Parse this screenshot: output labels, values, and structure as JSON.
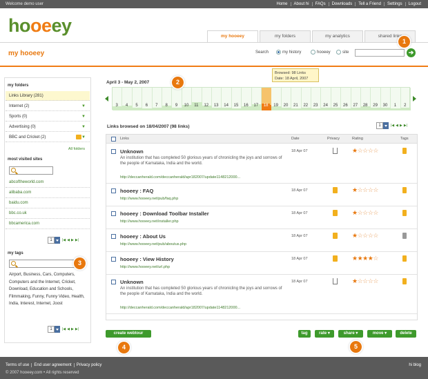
{
  "topbar": {
    "welcome": "Welcome demo user",
    "links": [
      "Home",
      "About hi",
      "FAQs",
      "Downloads",
      "Tell a Friend",
      "Settings",
      "Logout"
    ]
  },
  "brand": {
    "part1": "ho",
    "part2": "oe",
    "part3": "ey"
  },
  "tabs": [
    "my hooeey",
    "my folders",
    "my analytics",
    "shared links"
  ],
  "header": {
    "title": "my hooeey",
    "search_label": "Search",
    "radio_options": [
      "my history",
      "hooeey",
      "site"
    ],
    "radio_selected": "my history",
    "search_placeholder": "",
    "go_symbol": "➔"
  },
  "sidebar": {
    "folders_heading": "my folders",
    "folders": [
      {
        "label": "Links Library (281)"
      },
      {
        "label": "Internet (2)"
      },
      {
        "label": "Sports (0)"
      },
      {
        "label": "Advertising (0)"
      },
      {
        "label": "BBC and Cricket (2)"
      }
    ],
    "all_folders": "All folders",
    "most_visited_heading": "most visited sites",
    "sites": [
      "abcoftheworld.com",
      "alibaba.com",
      "baidu.com",
      "bbc.co.uk",
      "bbcamerica.com"
    ],
    "pager_value": "1",
    "tags_heading": "my tags",
    "tags_text": "Airport, Business, Cars, Computers, Computers and the Internet, Cricket, Download, Education and Schools, Filmmaking, Funny, Funny Video, Health, India, Interest, Internet, Joost"
  },
  "timeline": {
    "date_range": "April 3 - May 2, 2007",
    "tooltip_line1": "Browsed: 98 Links",
    "tooltip_line2": "Date: 18 April, 2007",
    "labels": [
      "3",
      "4",
      "5",
      "6",
      "7",
      "8",
      "9",
      "10",
      "11",
      "12",
      "13",
      "14",
      "15",
      "16",
      "17",
      "18",
      "19",
      "20",
      "21",
      "22",
      "23",
      "24",
      "25",
      "26",
      "27",
      "28",
      "29",
      "30",
      "1",
      "2"
    ],
    "values": [
      0.25,
      0.3,
      0.2,
      0.15,
      0.2,
      0.3,
      0.2,
      0.35,
      0.55,
      0.3,
      0.2,
      0.2,
      0.15,
      0.25,
      0.4,
      0.95,
      0.25,
      0.2,
      0.15,
      0.2,
      0.15,
      0.2,
      0.2,
      0.15,
      0.2,
      0.25,
      0.2,
      0.2,
      0.15,
      0.2
    ],
    "selected_index": 15
  },
  "list": {
    "title": "Links browsed on 18/04/2007 (98 links)",
    "pager_value": "1",
    "columns": {
      "links": "Links",
      "date": "Date",
      "privacy": "Privacy",
      "rating": "Rating",
      "tags": "Tags"
    },
    "rows": [
      {
        "title": "Unknown",
        "desc": "An institution that has completed 50 glorious years of chronicling the joys and sorrows of the people of Karnataka, India and the world.",
        "url": "http://deccanherald.com/deccanherald/apr182007/update1148212000...",
        "date": "18 Apr 07",
        "privacy": "open",
        "rating": 1,
        "tag": "yellow"
      },
      {
        "title": "hooeey : FAQ",
        "desc": "",
        "url": "http://www.hooeey.net/pub/faq.php",
        "date": "18 Apr 07",
        "privacy": "lock",
        "rating": 1,
        "tag": "yellow"
      },
      {
        "title": "hooeey : Download Toolbar Installer",
        "desc": "",
        "url": "http://www.hooeey.net/installer.php",
        "date": "18 Apr 07",
        "privacy": "lock",
        "rating": 1,
        "tag": "yellow"
      },
      {
        "title": "hooeey : About Us",
        "desc": "",
        "url": "http://www.hooeey.net/pub/aboutus.php",
        "date": "18 Apr 07",
        "privacy": "lock",
        "rating": 1,
        "tag": "grey"
      },
      {
        "title": "hooeey : View History",
        "desc": "",
        "url": "http://www.hooeey.net/url.php",
        "date": "18 Apr 07",
        "privacy": "lock",
        "rating": 4,
        "tag": "yellow"
      },
      {
        "title": "Unknown",
        "desc": "An institution that has completed 50 glorious years of chronicling the joys and sorrows of the people of Karnataka, India and the world.",
        "url": "http://deccanherald.com/deccanherald/apr182007/update1148212000...",
        "date": "18 Apr 07",
        "privacy": "open",
        "rating": 1,
        "tag": "yellow"
      }
    ]
  },
  "buttons": {
    "create_webtour": "create webtour",
    "tag": "tag",
    "rate": "rate ▾",
    "share": "share ▾",
    "move": "move ▾",
    "delete": "delete"
  },
  "callouts": [
    "1",
    "2",
    "3",
    "4",
    "5"
  ],
  "footer": {
    "links": [
      "Terms of use",
      "End user agreement",
      "Privacy policy"
    ],
    "copyright": "© 2007 hooeey.com • All rights reserved",
    "blog": "hi blog"
  },
  "colors": {
    "brand_green": "#5a8f2c",
    "brand_orange": "#f07c14",
    "button_green": "#3e9a2c"
  }
}
